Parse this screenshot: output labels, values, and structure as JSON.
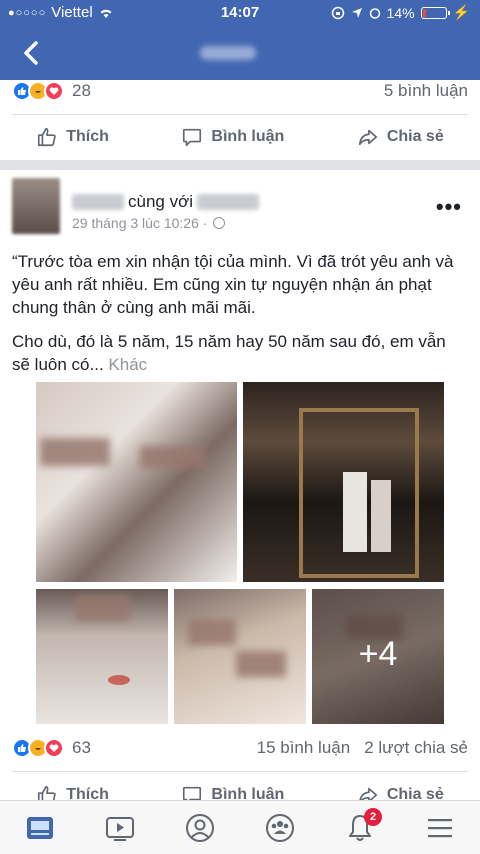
{
  "status_bar": {
    "carrier": "Viettel",
    "time": "14:07",
    "battery": "14%",
    "battery_level": 0.14
  },
  "top_post": {
    "reactions_count": "28",
    "comments": "5 bình luận",
    "actions": {
      "like": "Thích",
      "comment": "Bình luận",
      "share": "Chia sẻ"
    }
  },
  "post": {
    "with_text": "cùng với",
    "timestamp": "29 tháng 3 lúc 10:26 ·",
    "paragraph1": "“Trước tòa em xin nhận tội của mình. Vì đã trót yêu anh và yêu anh rất nhiều. Em cũng xin tự nguyện nhận án phạt chung thân ở cùng anh mãi mãi.",
    "paragraph2": "Cho dù, đó là 5 năm, 15 năm hay 50 năm sau đó, em vẫn sẽ luôn có...",
    "more_link": "Khác",
    "extra_photos": "+4",
    "reactions_count": "63",
    "comments": "15 bình luận",
    "shares": "2 lượt chia sẻ",
    "actions": {
      "like": "Thích",
      "comment": "Bình luận",
      "share": "Chia sẻ"
    }
  },
  "tab_bar": {
    "notifications_badge": "2"
  },
  "colors": {
    "brand": "#4267b2",
    "like": "#1877f2",
    "love": "#f33e58",
    "haha": "#f7b125"
  }
}
